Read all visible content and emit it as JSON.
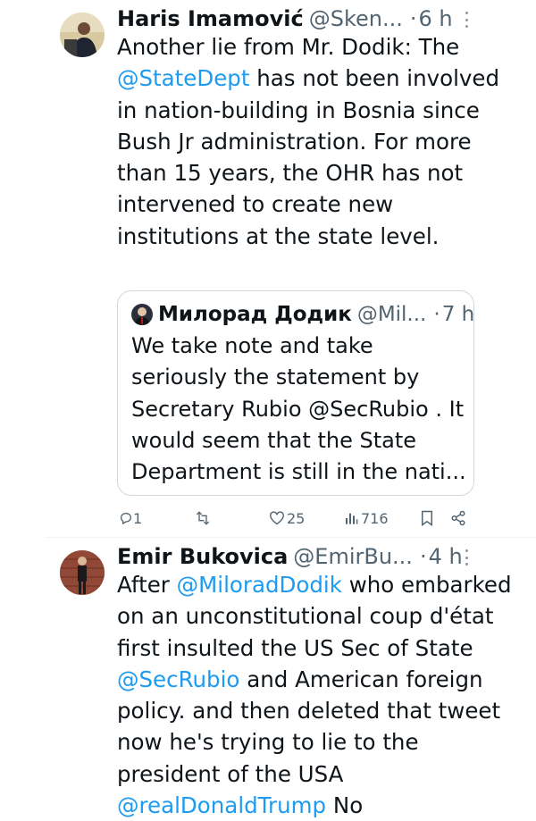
{
  "tweets": [
    {
      "name": "Haris Imamović",
      "handle": "@Sken...",
      "dot": "·",
      "time": "6 h",
      "text_before": "Another lie from Mr. Dodik: The ",
      "mention": "@StateDept",
      "text_after": " has not been involved in nation-building in Bosnia since Bush Jr administration. For more than 15 years, the OHR has not intervened to create new institutions at the state level.",
      "quote": {
        "name": "Милорад Додик",
        "handle": "@Mil...",
        "dot": "·",
        "time": "7 h",
        "text": "We take note and take seriously the statement by Secretary Rubio @SecRubio . It would seem that the State Department is still in the nati..."
      },
      "actions": {
        "replies": "1",
        "likes": "25",
        "views": "716"
      }
    },
    {
      "name": "Emir Bukovica",
      "handle": "@EmirBu...",
      "dot": "·",
      "time": "4 h",
      "t1": "After ",
      "m1": "@MiloradDodik",
      "t2": " who embarked on an unconstitutional coup d'état first insulted the US Sec of State ",
      "m2": "@SecRubio",
      "t3": " and American foreign policy. and then deleted that tweet now he's trying to lie to the president of the USA ",
      "m3": "@realDonaldTrump",
      "t4": " No"
    }
  ],
  "colors": {
    "link": "#1d9bf0",
    "muted": "#536471",
    "border": "#cfd9de"
  },
  "icons": [
    "reply-icon",
    "retweet-icon",
    "like-icon",
    "views-icon",
    "bookmark-icon",
    "share-icon",
    "more-icon"
  ]
}
